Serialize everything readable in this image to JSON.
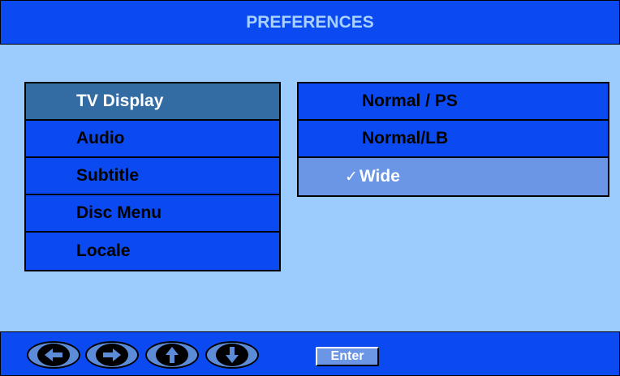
{
  "header": {
    "title": "PREFERENCES"
  },
  "categories": [
    {
      "label": "TV Display",
      "selected": true
    },
    {
      "label": "Audio",
      "selected": false
    },
    {
      "label": "Subtitle",
      "selected": false
    },
    {
      "label": "Disc Menu",
      "selected": false
    },
    {
      "label": "Locale",
      "selected": false
    }
  ],
  "options": [
    {
      "label": "Normal / PS",
      "checked": false
    },
    {
      "label": "Normal/LB",
      "checked": false
    },
    {
      "label": "Wide",
      "checked": true,
      "check_mark": "✓"
    }
  ],
  "footer": {
    "nav_buttons": [
      {
        "icon": "arrow-left-icon"
      },
      {
        "icon": "arrow-right-icon"
      },
      {
        "icon": "arrow-up-icon"
      },
      {
        "icon": "arrow-down-icon"
      }
    ],
    "enter_label": "Enter"
  },
  "colors": {
    "background": "#9ccbfd",
    "bar": "#0a4af0",
    "selected_category": "#336ba3",
    "selected_option": "#6b96e6",
    "title_text": "#a9d1ff"
  }
}
